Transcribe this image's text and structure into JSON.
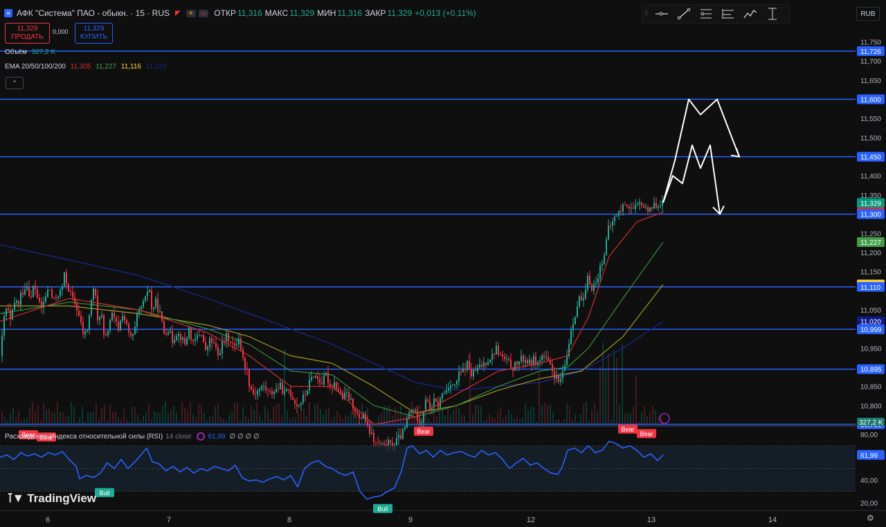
{
  "header": {
    "symbol_title": "АФК \"Система\" ПАО - обыкн. · 15 · RUS",
    "open_label": "ОТКР",
    "open_value": "11,316",
    "high_label": "МАКС",
    "high_value": "11,329",
    "low_label": "МИН",
    "low_value": "11,316",
    "close_label": "ЗАКР",
    "close_value": "11,329",
    "change": "+0,013 (+0,11%)",
    "currency": "RUB"
  },
  "trade": {
    "sell_price": "11,329",
    "sell_label": "ПРОДАТЬ",
    "spread": "0,000",
    "buy_price": "11,329",
    "buy_label": "КУПИТЬ"
  },
  "indicators": {
    "volume_label": "Объём",
    "volume_value": "327,2 K",
    "ema_label": "EMA 20/50/100/200",
    "ema20": "11,305",
    "ema50": "11,227",
    "ema100": "11,116",
    "ema200": "11,020"
  },
  "rsi": {
    "label": "Расхождение Индекса относительной силы (RSI)",
    "params": "14 close",
    "value": "61,99",
    "extras": "∅ ∅ ∅ ∅"
  },
  "brand": "TradingView",
  "colors": {
    "up": "#22ab94",
    "down": "#f23645",
    "level": "#2962ff",
    "ema20": "#d32f2f",
    "ema50": "#388e3c",
    "ema100": "#9e9d24",
    "ema200": "#1a237e",
    "rsi": "#2962ff"
  },
  "chart_data": {
    "type": "candlestick",
    "y_axis_ticks": [
      "11,750",
      "11,700",
      "11,650",
      "11,550",
      "11,500",
      "11,400",
      "11,350",
      "11,250",
      "11,200",
      "11,150",
      "11,050",
      "10,950",
      "10,850",
      "10,800"
    ],
    "ylim": [
      10.75,
      11.76
    ],
    "x_tick_labels": [
      "6",
      "7",
      "8",
      "9",
      "12",
      "13",
      "14"
    ],
    "levels": [
      11.726,
      11.6,
      11.45,
      11.3,
      11.11,
      10.999,
      10.895,
      10.751
    ],
    "price_tags": [
      {
        "text": "11,726",
        "value": 11.726,
        "bg": "#2962ff",
        "fg": "#ffffff"
      },
      {
        "text": "11,600",
        "value": 11.6,
        "bg": "#2962ff",
        "fg": "#ffffff"
      },
      {
        "text": "11,450",
        "value": 11.45,
        "bg": "#2962ff",
        "fg": "#ffffff"
      },
      {
        "text": "11,329",
        "value": 11.329,
        "bg": "#089981",
        "fg": "#ffffff"
      },
      {
        "text": "11,305",
        "value": 11.305,
        "bg": "#d32f2f",
        "fg": "#ffffff"
      },
      {
        "text": "11,300",
        "value": 11.3,
        "bg": "#2962ff",
        "fg": "#ffffff"
      },
      {
        "text": "11,227",
        "value": 11.227,
        "bg": "#43a047",
        "fg": "#ffffff"
      },
      {
        "text": "11,116",
        "value": 11.116,
        "bg": "#fdd835",
        "fg": "#000000"
      },
      {
        "text": "11,110",
        "value": 11.11,
        "bg": "#2962ff",
        "fg": "#ffffff"
      },
      {
        "text": "11,020",
        "value": 11.02,
        "bg": "#0d1a8c",
        "fg": "#ffffff"
      },
      {
        "text": "10,999",
        "value": 10.999,
        "bg": "#2962ff",
        "fg": "#ffffff"
      },
      {
        "text": "10,895",
        "value": 10.895,
        "bg": "#2962ff",
        "fg": "#ffffff"
      },
      {
        "text": "10,751",
        "value": 10.751,
        "bg": "#2962ff",
        "fg": "#ffffff"
      }
    ],
    "volume_tag": "327,2 K",
    "close_path": [
      [
        0,
        10.93
      ],
      [
        4,
        11.02
      ],
      [
        9,
        11.06
      ],
      [
        14,
        11.02
      ],
      [
        18,
        11.05
      ],
      [
        22,
        11.08
      ],
      [
        26,
        11.06
      ],
      [
        29,
        11.09
      ],
      [
        33,
        11.1
      ],
      [
        37,
        11.12
      ],
      [
        40,
        11.1
      ],
      [
        44,
        11.08
      ],
      [
        48,
        11.12
      ],
      [
        52,
        11.09
      ],
      [
        58,
        11.05
      ],
      [
        64,
        11.08
      ],
      [
        70,
        11.11
      ],
      [
        76,
        11.07
      ],
      [
        82,
        11.09
      ],
      [
        88,
        11.1
      ],
      [
        92,
        11.14
      ],
      [
        97,
        11.11
      ],
      [
        103,
        11.08
      ],
      [
        109,
        11.06
      ],
      [
        115,
        11.02
      ],
      [
        120,
        10.98
      ],
      [
        125,
        11.0
      ],
      [
        130,
        11.06
      ],
      [
        135,
        11.12
      ],
      [
        140,
        11.02
      ],
      [
        145,
        11.05
      ],
      [
        150,
        10.96
      ],
      [
        155,
        11.0
      ],
      [
        160,
        11.04
      ],
      [
        165,
        11.02
      ],
      [
        170,
        11.0
      ],
      [
        176,
        11.04
      ],
      [
        180,
        11.02
      ],
      [
        186,
        10.98
      ],
      [
        192,
        10.98
      ],
      [
        198,
        11.04
      ],
      [
        204,
        11.06
      ],
      [
        210,
        11.08
      ],
      [
        214,
        11.12
      ],
      [
        218,
        11.05
      ],
      [
        224,
        11.07
      ],
      [
        230,
        11.04
      ],
      [
        236,
        10.99
      ],
      [
        242,
        11.0
      ],
      [
        248,
        10.97
      ],
      [
        254,
        10.99
      ],
      [
        260,
        10.98
      ],
      [
        266,
        10.96
      ],
      [
        272,
        11.0
      ],
      [
        278,
        10.96
      ],
      [
        284,
        10.98
      ],
      [
        290,
        10.99
      ],
      [
        296,
        10.94
      ],
      [
        302,
        10.97
      ],
      [
        308,
        10.96
      ],
      [
        314,
        10.93
      ],
      [
        320,
        10.96
      ],
      [
        326,
        10.98
      ],
      [
        332,
        10.97
      ],
      [
        338,
        10.95
      ],
      [
        344,
        10.98
      ],
      [
        350,
        10.92
      ],
      [
        356,
        10.89
      ],
      [
        360,
        10.85
      ],
      [
        366,
        10.83
      ],
      [
        372,
        10.84
      ],
      [
        380,
        10.85
      ],
      [
        388,
        10.83
      ],
      [
        396,
        10.84
      ],
      [
        404,
        10.85
      ],
      [
        410,
        10.83
      ],
      [
        416,
        10.84
      ],
      [
        422,
        10.82
      ],
      [
        428,
        10.8
      ],
      [
        434,
        10.81
      ],
      [
        440,
        10.83
      ],
      [
        446,
        10.86
      ],
      [
        452,
        10.88
      ],
      [
        458,
        10.87
      ],
      [
        464,
        10.86
      ],
      [
        470,
        10.88
      ],
      [
        476,
        10.85
      ],
      [
        482,
        10.86
      ],
      [
        488,
        10.84
      ],
      [
        494,
        10.82
      ],
      [
        500,
        10.83
      ],
      [
        506,
        10.81
      ],
      [
        512,
        10.79
      ],
      [
        518,
        10.76
      ],
      [
        524,
        10.78
      ],
      [
        530,
        10.74
      ],
      [
        536,
        10.72
      ],
      [
        542,
        10.7
      ],
      [
        548,
        10.7
      ],
      [
        554,
        10.69
      ],
      [
        560,
        10.7
      ],
      [
        566,
        10.69
      ],
      [
        572,
        10.71
      ],
      [
        578,
        10.72
      ],
      [
        584,
        10.74
      ],
      [
        590,
        10.78
      ],
      [
        596,
        10.79
      ],
      [
        602,
        10.77
      ],
      [
        608,
        10.76
      ],
      [
        614,
        10.82
      ],
      [
        620,
        10.79
      ],
      [
        626,
        10.81
      ],
      [
        632,
        10.8
      ],
      [
        638,
        10.83
      ],
      [
        644,
        10.84
      ],
      [
        650,
        10.86
      ],
      [
        656,
        10.85
      ],
      [
        662,
        10.88
      ],
      [
        668,
        10.89
      ],
      [
        674,
        10.91
      ],
      [
        680,
        10.88
      ],
      [
        686,
        10.89
      ],
      [
        692,
        10.9
      ],
      [
        698,
        10.91
      ],
      [
        704,
        10.92
      ],
      [
        710,
        10.93
      ],
      [
        716,
        10.95
      ],
      [
        722,
        10.93
      ],
      [
        728,
        10.92
      ],
      [
        734,
        10.91
      ],
      [
        740,
        10.9
      ],
      [
        746,
        10.91
      ],
      [
        752,
        10.92
      ],
      [
        758,
        10.92
      ],
      [
        764,
        10.91
      ],
      [
        770,
        10.92
      ],
      [
        776,
        10.91
      ],
      [
        782,
        10.93
      ],
      [
        788,
        10.92
      ],
      [
        794,
        10.9
      ],
      [
        800,
        10.88
      ],
      [
        806,
        10.86
      ],
      [
        812,
        10.88
      ],
      [
        818,
        10.93
      ],
      [
        824,
        11.0
      ],
      [
        830,
        11.04
      ],
      [
        836,
        11.08
      ],
      [
        842,
        11.07
      ],
      [
        848,
        11.13
      ],
      [
        854,
        11.11
      ],
      [
        860,
        11.12
      ],
      [
        866,
        11.16
      ],
      [
        872,
        11.2
      ],
      [
        878,
        11.26
      ],
      [
        884,
        11.28
      ],
      [
        890,
        11.3
      ],
      [
        896,
        11.31
      ],
      [
        902,
        11.33
      ],
      [
        908,
        11.32
      ],
      [
        914,
        11.31
      ],
      [
        920,
        11.32
      ],
      [
        926,
        11.33
      ],
      [
        932,
        11.31
      ],
      [
        938,
        11.32
      ],
      [
        944,
        11.32
      ],
      [
        950,
        11.33
      ],
      [
        958,
        11.329
      ]
    ],
    "ema20": [
      [
        0,
        11.02
      ],
      [
        100,
        11.08
      ],
      [
        200,
        11.05
      ],
      [
        300,
        10.99
      ],
      [
        360,
        10.93
      ],
      [
        420,
        10.85
      ],
      [
        480,
        10.85
      ],
      [
        540,
        10.75
      ],
      [
        600,
        10.77
      ],
      [
        660,
        10.83
      ],
      [
        720,
        10.89
      ],
      [
        780,
        10.91
      ],
      [
        820,
        10.93
      ],
      [
        850,
        11.03
      ],
      [
        880,
        11.19
      ],
      [
        920,
        11.28
      ],
      [
        958,
        11.305
      ]
    ],
    "ema50": [
      [
        0,
        11.04
      ],
      [
        100,
        11.07
      ],
      [
        200,
        11.05
      ],
      [
        300,
        11.0
      ],
      [
        360,
        10.96
      ],
      [
        420,
        10.89
      ],
      [
        480,
        10.88
      ],
      [
        540,
        10.8
      ],
      [
        600,
        10.77
      ],
      [
        660,
        10.8
      ],
      [
        720,
        10.85
      ],
      [
        780,
        10.89
      ],
      [
        820,
        10.9
      ],
      [
        850,
        10.95
      ],
      [
        900,
        11.08
      ],
      [
        958,
        11.227
      ]
    ],
    "ema100": [
      [
        0,
        11.06
      ],
      [
        100,
        11.06
      ],
      [
        200,
        11.04
      ],
      [
        300,
        11.01
      ],
      [
        360,
        10.98
      ],
      [
        420,
        10.93
      ],
      [
        480,
        10.91
      ],
      [
        540,
        10.85
      ],
      [
        600,
        10.78
      ],
      [
        660,
        10.8
      ],
      [
        720,
        10.84
      ],
      [
        780,
        10.87
      ],
      [
        840,
        10.89
      ],
      [
        900,
        10.98
      ],
      [
        958,
        11.116
      ]
    ],
    "ema200": [
      [
        0,
        11.22
      ],
      [
        100,
        11.18
      ],
      [
        200,
        11.14
      ],
      [
        300,
        11.08
      ],
      [
        360,
        11.04
      ],
      [
        420,
        11.0
      ],
      [
        480,
        10.96
      ],
      [
        540,
        10.91
      ],
      [
        600,
        10.86
      ],
      [
        660,
        10.84
      ],
      [
        720,
        10.85
      ],
      [
        780,
        10.86
      ],
      [
        840,
        10.89
      ],
      [
        900,
        10.95
      ],
      [
        958,
        11.02
      ]
    ],
    "forecast_upper": [
      [
        958,
        11.33
      ],
      [
        975,
        11.44
      ],
      [
        995,
        11.6
      ],
      [
        1012,
        11.56
      ],
      [
        1036,
        11.6
      ],
      [
        1068,
        11.45
      ]
    ],
    "forecast_lower": [
      [
        958,
        11.33
      ],
      [
        972,
        11.4
      ],
      [
        986,
        11.38
      ],
      [
        1000,
        11.48
      ],
      [
        1012,
        11.42
      ],
      [
        1026,
        11.48
      ],
      [
        1040,
        11.3
      ]
    ],
    "rsi_ylim": [
      15,
      85
    ],
    "rsi_ticks": [
      "80,00",
      "40,00",
      "20,00"
    ],
    "rsi_bands": [
      70,
      30
    ],
    "rsi_values": [
      [
        0,
        60
      ],
      [
        10,
        62
      ],
      [
        20,
        58
      ],
      [
        30,
        64
      ],
      [
        40,
        61
      ],
      [
        50,
        63
      ],
      [
        60,
        60
      ],
      [
        70,
        64
      ],
      [
        80,
        62
      ],
      [
        90,
        65
      ],
      [
        100,
        58
      ],
      [
        110,
        52
      ],
      [
        115,
        41
      ],
      [
        125,
        44
      ],
      [
        135,
        42
      ],
      [
        145,
        46
      ],
      [
        155,
        55
      ],
      [
        165,
        50
      ],
      [
        175,
        58
      ],
      [
        185,
        50
      ],
      [
        195,
        56
      ],
      [
        205,
        63
      ],
      [
        212,
        68
      ],
      [
        220,
        56
      ],
      [
        230,
        54
      ],
      [
        240,
        48
      ],
      [
        250,
        52
      ],
      [
        260,
        47
      ],
      [
        270,
        51
      ],
      [
        280,
        46
      ],
      [
        290,
        50
      ],
      [
        300,
        48
      ],
      [
        310,
        52
      ],
      [
        320,
        50
      ],
      [
        330,
        48
      ],
      [
        340,
        53
      ],
      [
        350,
        42
      ],
      [
        360,
        39
      ],
      [
        370,
        40
      ],
      [
        380,
        38
      ],
      [
        390,
        41
      ],
      [
        400,
        43
      ],
      [
        410,
        40
      ],
      [
        420,
        44
      ],
      [
        430,
        34
      ],
      [
        440,
        50
      ],
      [
        450,
        55
      ],
      [
        460,
        57
      ],
      [
        470,
        52
      ],
      [
        480,
        50
      ],
      [
        490,
        46
      ],
      [
        500,
        44
      ],
      [
        510,
        47
      ],
      [
        520,
        30
      ],
      [
        530,
        23
      ],
      [
        540,
        25
      ],
      [
        550,
        26
      ],
      [
        560,
        30
      ],
      [
        570,
        33
      ],
      [
        580,
        48
      ],
      [
        588,
        68
      ],
      [
        596,
        70
      ],
      [
        606,
        63
      ],
      [
        616,
        66
      ],
      [
        626,
        60
      ],
      [
        636,
        66
      ],
      [
        646,
        62
      ],
      [
        656,
        64
      ],
      [
        666,
        65
      ],
      [
        676,
        62
      ],
      [
        686,
        60
      ],
      [
        696,
        66
      ],
      [
        706,
        62
      ],
      [
        716,
        64
      ],
      [
        726,
        58
      ],
      [
        736,
        50
      ],
      [
        746,
        55
      ],
      [
        756,
        59
      ],
      [
        766,
        53
      ],
      [
        776,
        55
      ],
      [
        786,
        50
      ],
      [
        796,
        46
      ],
      [
        806,
        45
      ],
      [
        812,
        51
      ],
      [
        820,
        66
      ],
      [
        830,
        68
      ],
      [
        840,
        64
      ],
      [
        850,
        70
      ],
      [
        860,
        64
      ],
      [
        870,
        66
      ],
      [
        880,
        74
      ],
      [
        890,
        72
      ],
      [
        900,
        68
      ],
      [
        910,
        70
      ],
      [
        920,
        66
      ],
      [
        930,
        60
      ],
      [
        940,
        63
      ],
      [
        950,
        57
      ],
      [
        958,
        61.99
      ]
    ],
    "rsi_labels": [
      {
        "text": "Bear",
        "x": 41,
        "y": 74,
        "kind": "bear"
      },
      {
        "text": "Bear",
        "x": 67,
        "y": 72,
        "kind": "bear"
      },
      {
        "text": "Bull",
        "x": 151,
        "y": 34,
        "kind": "bull"
      },
      {
        "text": "Bear",
        "x": 612,
        "y": 77,
        "kind": "bear"
      },
      {
        "text": "Bull",
        "x": 553,
        "y": 20,
        "kind": "bull"
      },
      {
        "text": "Bear",
        "x": 907,
        "y": 79,
        "kind": "bear"
      },
      {
        "text": "Bear",
        "x": 934,
        "y": 75,
        "kind": "bear"
      }
    ]
  }
}
